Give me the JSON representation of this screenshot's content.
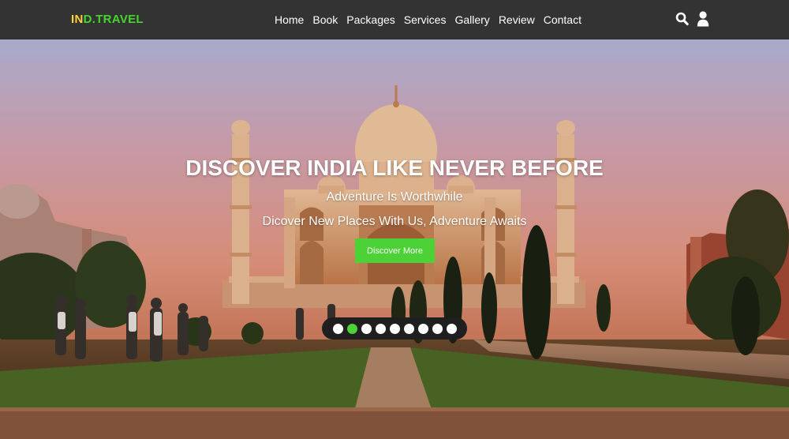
{
  "brand": {
    "logo_accent": "IN",
    "logo_rest": "D.TRAVEL",
    "accent_color": "#ffd23a",
    "brand_color": "#44d62c"
  },
  "nav": {
    "links": [
      "Home",
      "Book",
      "Packages",
      "Services",
      "Gallery",
      "Review",
      "Contact"
    ],
    "icons": [
      "search-icon",
      "user-icon"
    ]
  },
  "hero": {
    "title": "DISCOVER INDIA LIKE NEVER BEFORE",
    "subtitle": "Adventure Is Worthwhile",
    "tagline": "Dicover New Places With Us, Adventure Awaits",
    "cta_label": "Discover More",
    "cta_color": "#4cd137",
    "background_image": "Taj Mahal at sunset with gardens and visitors"
  },
  "slider": {
    "total_slides": 9,
    "active_index": 1,
    "active_color": "#4cd137"
  }
}
